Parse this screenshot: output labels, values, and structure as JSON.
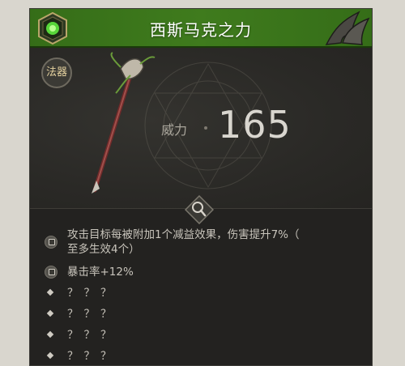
{
  "header": {
    "title": "西斯马克之力"
  },
  "item": {
    "type_badge": "法器",
    "power_label": "威力",
    "power_value": "165"
  },
  "effects": [
    {
      "locked": true,
      "text_line1": "攻击目标每被附加1个减益效果，伤害提升7%（",
      "text_line2": "至多生效4个）"
    },
    {
      "locked": true,
      "text_line1": "暴击率+12%"
    },
    {
      "locked": false,
      "text_line1": "？？？"
    },
    {
      "locked": false,
      "text_line1": "？？？"
    },
    {
      "locked": false,
      "text_line1": "？？？"
    },
    {
      "locked": false,
      "text_line1": "？？？"
    }
  ],
  "icons": {
    "emblem": "green-orb-emblem-icon",
    "horn": "horn-ornament-icon",
    "search": "magnifier-icon",
    "lock": "lock-icon",
    "bullet": "diamond-bullet-icon"
  },
  "colors": {
    "header_green": "#3f7b1d",
    "panel_dark": "#2b2a27",
    "text_light": "#c8c4bb"
  }
}
